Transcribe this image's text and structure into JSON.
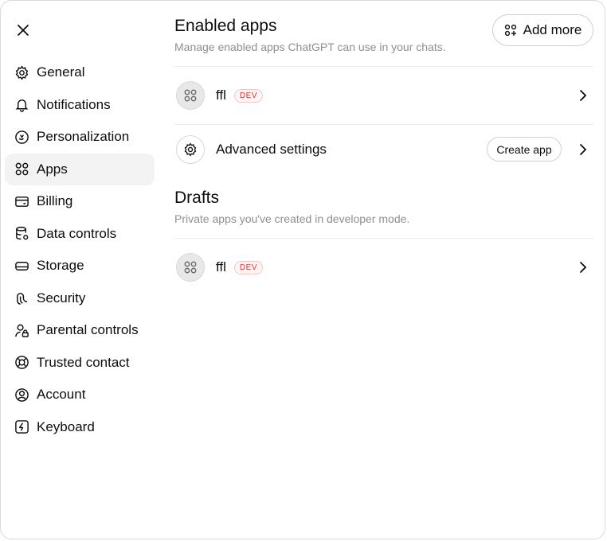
{
  "sidebar": {
    "items": [
      {
        "label": "General",
        "icon": "gear-icon"
      },
      {
        "label": "Notifications",
        "icon": "bell-icon"
      },
      {
        "label": "Personalization",
        "icon": "personalization-icon"
      },
      {
        "label": "Apps",
        "icon": "apps-icon",
        "active": true
      },
      {
        "label": "Billing",
        "icon": "card-icon"
      },
      {
        "label": "Data controls",
        "icon": "database-icon"
      },
      {
        "label": "Storage",
        "icon": "storage-icon"
      },
      {
        "label": "Security",
        "icon": "security-icon"
      },
      {
        "label": "Parental controls",
        "icon": "parental-icon"
      },
      {
        "label": "Trusted contact",
        "icon": "lifebuoy-icon"
      },
      {
        "label": "Account",
        "icon": "account-icon"
      },
      {
        "label": "Keyboard",
        "icon": "keyboard-icon"
      }
    ]
  },
  "enabled": {
    "title": "Enabled apps",
    "subtitle": "Manage enabled apps ChatGPT can use in your chats.",
    "add_more": "Add more",
    "apps": [
      {
        "name": "ffl",
        "badge": "DEV"
      }
    ],
    "advanced": "Advanced settings",
    "create_app": "Create app"
  },
  "drafts": {
    "title": "Drafts",
    "subtitle": "Private apps you've created in developer mode.",
    "apps": [
      {
        "name": "ffl",
        "badge": "DEV"
      }
    ]
  },
  "colors": {
    "active_bg": "#f3f3f3",
    "badge_red": "#e02e2e",
    "muted": "#8f8f8f"
  }
}
